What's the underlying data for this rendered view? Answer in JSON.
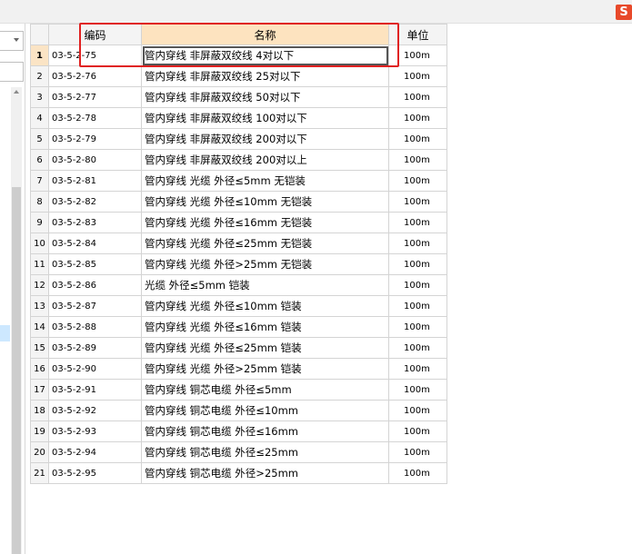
{
  "grid": {
    "headers": {
      "code": "编码",
      "name": "名称",
      "unit": "单位"
    },
    "rows": [
      {
        "num": "1",
        "code": "03-5-2-75",
        "name": "管内穿线 非屏蔽双绞线 4对以下",
        "unit": "100m"
      },
      {
        "num": "2",
        "code": "03-5-2-76",
        "name": "管内穿线 非屏蔽双绞线 25对以下",
        "unit": "100m"
      },
      {
        "num": "3",
        "code": "03-5-2-77",
        "name": "管内穿线 非屏蔽双绞线 50对以下",
        "unit": "100m"
      },
      {
        "num": "4",
        "code": "03-5-2-78",
        "name": "管内穿线 非屏蔽双绞线 100对以下",
        "unit": "100m"
      },
      {
        "num": "5",
        "code": "03-5-2-79",
        "name": "管内穿线 非屏蔽双绞线 200对以下",
        "unit": "100m"
      },
      {
        "num": "6",
        "code": "03-5-2-80",
        "name": "管内穿线 非屏蔽双绞线 200对以上",
        "unit": "100m"
      },
      {
        "num": "7",
        "code": "03-5-2-81",
        "name": "管内穿线 光缆 外径≤5mm 无铠装",
        "unit": "100m"
      },
      {
        "num": "8",
        "code": "03-5-2-82",
        "name": "管内穿线 光缆 外径≤10mm 无铠装",
        "unit": "100m"
      },
      {
        "num": "9",
        "code": "03-5-2-83",
        "name": "管内穿线 光缆 外径≤16mm 无铠装",
        "unit": "100m"
      },
      {
        "num": "10",
        "code": "03-5-2-84",
        "name": "管内穿线 光缆 外径≤25mm 无铠装",
        "unit": "100m"
      },
      {
        "num": "11",
        "code": "03-5-2-85",
        "name": "管内穿线 光缆 外径>25mm 无铠装",
        "unit": "100m"
      },
      {
        "num": "12",
        "code": "03-5-2-86",
        "name": "光缆 外径≤5mm 铠装",
        "unit": "100m"
      },
      {
        "num": "13",
        "code": "03-5-2-87",
        "name": "管内穿线 光缆 外径≤10mm 铠装",
        "unit": "100m"
      },
      {
        "num": "14",
        "code": "03-5-2-88",
        "name": "管内穿线 光缆 外径≤16mm 铠装",
        "unit": "100m"
      },
      {
        "num": "15",
        "code": "03-5-2-89",
        "name": "管内穿线 光缆 外径≤25mm 铠装",
        "unit": "100m"
      },
      {
        "num": "16",
        "code": "03-5-2-90",
        "name": "管内穿线 光缆 外径>25mm 铠装",
        "unit": "100m"
      },
      {
        "num": "17",
        "code": "03-5-2-91",
        "name": "管内穿线 铜芯电缆 外径≤5mm",
        "unit": "100m"
      },
      {
        "num": "18",
        "code": "03-5-2-92",
        "name": "管内穿线 铜芯电缆 外径≤10mm",
        "unit": "100m"
      },
      {
        "num": "19",
        "code": "03-5-2-93",
        "name": "管内穿线 铜芯电缆 外径≤16mm",
        "unit": "100m"
      },
      {
        "num": "20",
        "code": "03-5-2-94",
        "name": "管内穿线 铜芯电缆 外径≤25mm",
        "unit": "100m"
      },
      {
        "num": "21",
        "code": "03-5-2-95",
        "name": "管内穿线 铜芯电缆 外径>25mm",
        "unit": "100m"
      }
    ],
    "active_row": 0
  },
  "logo": {
    "letter": "S",
    "color": "#e8492a"
  },
  "highlight": {
    "color": "#e02020"
  }
}
